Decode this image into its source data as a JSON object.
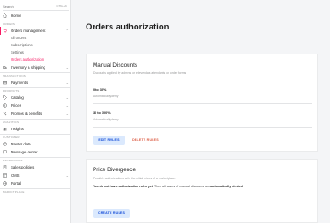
{
  "sidebar": {
    "search": {
      "placeholder": "Search",
      "shortcut": "CTRL+K"
    },
    "home_label": "Home",
    "sections": {
      "orders": "ORDERS",
      "transactions": "TRANSACTIONS",
      "products": "PRODUCTS",
      "analytics": "ANALYTICS",
      "customer": "CUSTOMER",
      "storefront": "STOREFRONT",
      "marketplace": "MARKETPLACE"
    },
    "orders_management": {
      "label": "Orders management",
      "children": [
        "All orders",
        "Subscriptions",
        "Settings",
        "Orders authorization"
      ]
    },
    "inventory": "Inventory & shipping",
    "payments": "Payments",
    "catalog": "Catalog",
    "prices": "Prices",
    "promos": "Promos & benefits",
    "insights": "Insights",
    "master_data": "Master data",
    "message_center": "Message center",
    "sales_policies": "Sales policies",
    "cms": "CMS",
    "portal": "Portal"
  },
  "main": {
    "title": "Orders authorization",
    "manual_discounts": {
      "title": "Manual Discounts",
      "description": "Discounts applied by admins or televendas attendants on order forms.",
      "rules": [
        {
          "title": "0 to 30%",
          "subtitle": "Automatically deny"
        },
        {
          "title": "30 to 100%",
          "subtitle": "Automatically deny"
        }
      ],
      "edit_label": "EDIT RULES",
      "delete_label": "DELETE RULES"
    },
    "price_divergence": {
      "title": "Price Divergence",
      "description": "Possible authorizations with the initial prices of a marketplace.",
      "notice_bold1": "You do not have authorization rules yet.",
      "notice_text": " Then all cases of manual discounts are ",
      "notice_bold2": "automatically denied.",
      "create_label": "CREATE RULES"
    }
  },
  "colors": {
    "accent": "#f71963",
    "primary": "#134cd8",
    "danger": "#dc5a41"
  }
}
